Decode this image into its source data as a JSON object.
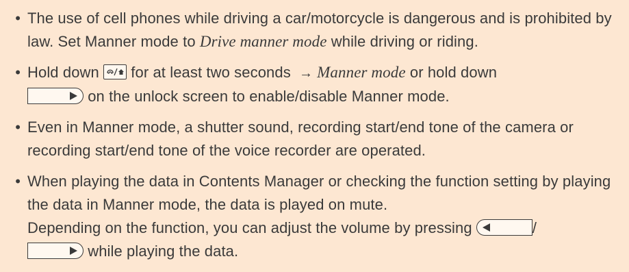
{
  "notes": [
    {
      "t1": "The use of cell phones while driving a car/motorcycle is dangerous and is prohibited by law. Set Manner mode to ",
      "t2": "Drive manner mode",
      "t3": " while driving or riding."
    },
    {
      "t1": "Hold down ",
      "t2": " for at least two seconds ",
      "arrow": "→",
      "t3": "Manner mode",
      "t4": " or hold down ",
      "t5": " on the unlock screen to enable/disable Manner mode."
    },
    {
      "t1": "Even in Manner mode, a shutter sound, recording start/end tone of the camera or recording start/end tone of the voice recorder are operated."
    },
    {
      "t1": "When playing the data in Contents Manager or checking the function setting by playing the data in Manner mode, the data is played on mute.",
      "t2": "Depending on the function, you can adjust the volume by pressing ",
      "sep": "/",
      "t3": " while playing the data."
    }
  ],
  "bullet_glyph": "•",
  "icons": {
    "manner_key": "phone-manner-key-icon",
    "right_key": "right-arrow-key-icon",
    "left_key": "left-arrow-key-icon"
  },
  "colors": {
    "background": "#fde7d2",
    "text": "#3a3a3a"
  }
}
